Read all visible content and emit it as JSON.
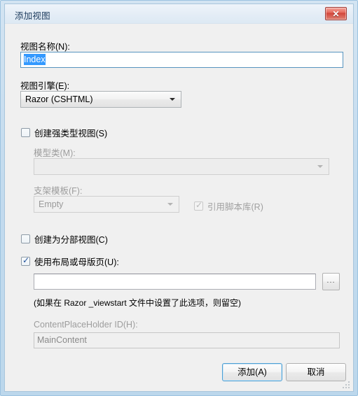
{
  "window": {
    "title": "添加视图",
    "close_label": "✕",
    "close_icon": "close-icon"
  },
  "form": {
    "view_name": {
      "label": "视图名称(N):",
      "label_plain": "视图名称",
      "accel": "N",
      "value": "Index",
      "placeholder": "",
      "selected": true,
      "enabled": true
    },
    "view_engine": {
      "label": "视图引擎(E):",
      "label_plain": "视图引擎",
      "accel": "E",
      "value": "Razor (CSHTML)",
      "enabled": true,
      "options": [
        "Razor (CSHTML)"
      ]
    },
    "strongly_typed": {
      "label": "创建强类型视图(S)",
      "label_plain": "创建强类型视图",
      "accel": "S",
      "checked": false,
      "enabled": true
    },
    "model_class": {
      "label": "模型类(M):",
      "label_plain": "模型类",
      "accel": "M",
      "value": "",
      "enabled": false
    },
    "scaffold_template": {
      "label": "支架模板(F):",
      "label_plain": "支架模板",
      "accel": "F",
      "value": "Empty",
      "enabled": false,
      "options": [
        "Empty"
      ]
    },
    "reference_script_libraries": {
      "label": "引用脚本库(R)",
      "label_plain": "引用脚本库",
      "accel": "R",
      "checked": true,
      "enabled": false
    },
    "create_partial_view": {
      "label": "创建为分部视图(C)",
      "label_plain": "创建为分部视图",
      "accel": "C",
      "checked": false,
      "enabled": true
    },
    "use_layout_page": {
      "label": "使用布局或母版页(U):",
      "label_plain": "使用布局或母版页",
      "accel": "U",
      "checked": true,
      "enabled": true
    },
    "layout_page": {
      "value": "",
      "placeholder": "",
      "enabled": true,
      "browse_label": "..."
    },
    "layout_hint": "(如果在 Razor _viewstart 文件中设置了此选项，则留空)",
    "content_placeholder_id": {
      "label": "ContentPlaceHolder ID(H):",
      "label_plain": "ContentPlaceHolder ID",
      "accel": "H",
      "value": "MainContent",
      "enabled": false
    }
  },
  "buttons": {
    "add": "添加(A)",
    "add_accel": "A",
    "cancel": "取消"
  },
  "colors": {
    "window_frame": "#bcd7ec",
    "dialog_background": "#f0f0f0",
    "selection_blue": "#3399ff",
    "default_button_border": "#4c9fd4",
    "close_button_red": "#d2453a",
    "disabled_text": "#9a9a9a"
  }
}
